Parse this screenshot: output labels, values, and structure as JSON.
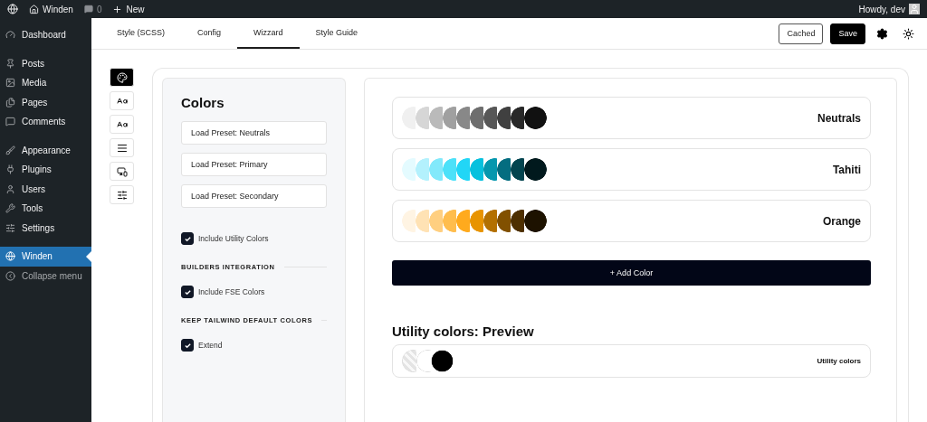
{
  "admin_bar": {
    "site": "Winden",
    "comments": "0",
    "new": "New",
    "greeting": "Howdy, dev"
  },
  "sidebar": {
    "groups": [
      {
        "items": [
          {
            "label": "Dashboard",
            "selected": false
          }
        ]
      },
      {
        "items": [
          {
            "label": "Posts",
            "selected": false
          },
          {
            "label": "Media",
            "selected": false
          },
          {
            "label": "Pages",
            "selected": false
          },
          {
            "label": "Comments",
            "selected": false
          }
        ]
      },
      {
        "items": [
          {
            "label": "Appearance",
            "selected": false
          },
          {
            "label": "Plugins",
            "selected": false
          },
          {
            "label": "Users",
            "selected": false
          },
          {
            "label": "Tools",
            "selected": false
          },
          {
            "label": "Settings",
            "selected": false
          }
        ]
      },
      {
        "items": [
          {
            "label": "Winden",
            "selected": true
          },
          {
            "label": "Collapse menu",
            "selected": false
          }
        ]
      }
    ]
  },
  "tabs": [
    {
      "label": "Style (SCSS)",
      "selected": false
    },
    {
      "label": "Config",
      "selected": false
    },
    {
      "label": "Wizzard",
      "selected": true
    },
    {
      "label": "Style Guide",
      "selected": false
    }
  ],
  "toolbar": {
    "cached": "Cached",
    "save": "Save"
  },
  "tool_icons": [
    {
      "selected": true
    },
    {
      "selected": false
    },
    {
      "selected": false
    },
    {
      "selected": false
    },
    {
      "selected": false
    },
    {
      "selected": false
    }
  ],
  "settings_panel": {
    "title": "Colors",
    "presets": [
      "Load Preset: Neutrals",
      "Load Preset: Primary",
      "Load Preset: Secondary"
    ],
    "sections": [
      {
        "options": [
          {
            "label": "Include Utility Colors",
            "checked": true
          }
        ]
      },
      {
        "heading": "BUILDERS INTEGRATION",
        "options": [
          {
            "label": "Include FSE Colors",
            "checked": true
          }
        ]
      },
      {
        "heading": "KEEP TAILWIND DEFAULT COLORS",
        "options": [
          {
            "label": "Extend",
            "checked": true
          }
        ]
      }
    ]
  },
  "palettes": [
    {
      "name": "Neutrals",
      "swatches": [
        {
          "color": "#f0f0f0"
        },
        {
          "color": "#d6d6d6"
        },
        {
          "color": "#bababa"
        },
        {
          "color": "#a0a0a0"
        },
        {
          "color": "#888888"
        },
        {
          "color": "#6e6e6e"
        },
        {
          "color": "#575757"
        },
        {
          "color": "#404040"
        },
        {
          "color": "#282828"
        },
        {
          "color": "#111111"
        }
      ]
    },
    {
      "name": "Tahiti",
      "swatches": [
        {
          "color": "#e4fbff"
        },
        {
          "color": "#b3f1fd"
        },
        {
          "color": "#82e9fb"
        },
        {
          "color": "#4ce1f9"
        },
        {
          "color": "#22d6f6"
        },
        {
          "color": "#07c1de"
        },
        {
          "color": "#0597ae"
        },
        {
          "color": "#046d80"
        },
        {
          "color": "#03444f"
        },
        {
          "color": "#01191d"
        }
      ]
    },
    {
      "name": "Orange",
      "swatches": [
        {
          "color": "#fff4e3"
        },
        {
          "color": "#ffe2b4"
        },
        {
          "color": "#ffcf80"
        },
        {
          "color": "#ffbd4d"
        },
        {
          "color": "#ffaa1d"
        },
        {
          "color": "#e89400"
        },
        {
          "color": "#b37000"
        },
        {
          "color": "#815000"
        },
        {
          "color": "#4d2f00"
        },
        {
          "color": "#1d1200"
        }
      ]
    }
  ],
  "add_color": "+ Add Color",
  "utility_preview": {
    "title": "Utility colors: Preview",
    "label": "Utility colors",
    "swatches": [
      {
        "kind": "transparent"
      },
      {
        "kind": "solid",
        "color": "#ffffff"
      },
      {
        "kind": "solid",
        "color": "#000000"
      }
    ]
  }
}
